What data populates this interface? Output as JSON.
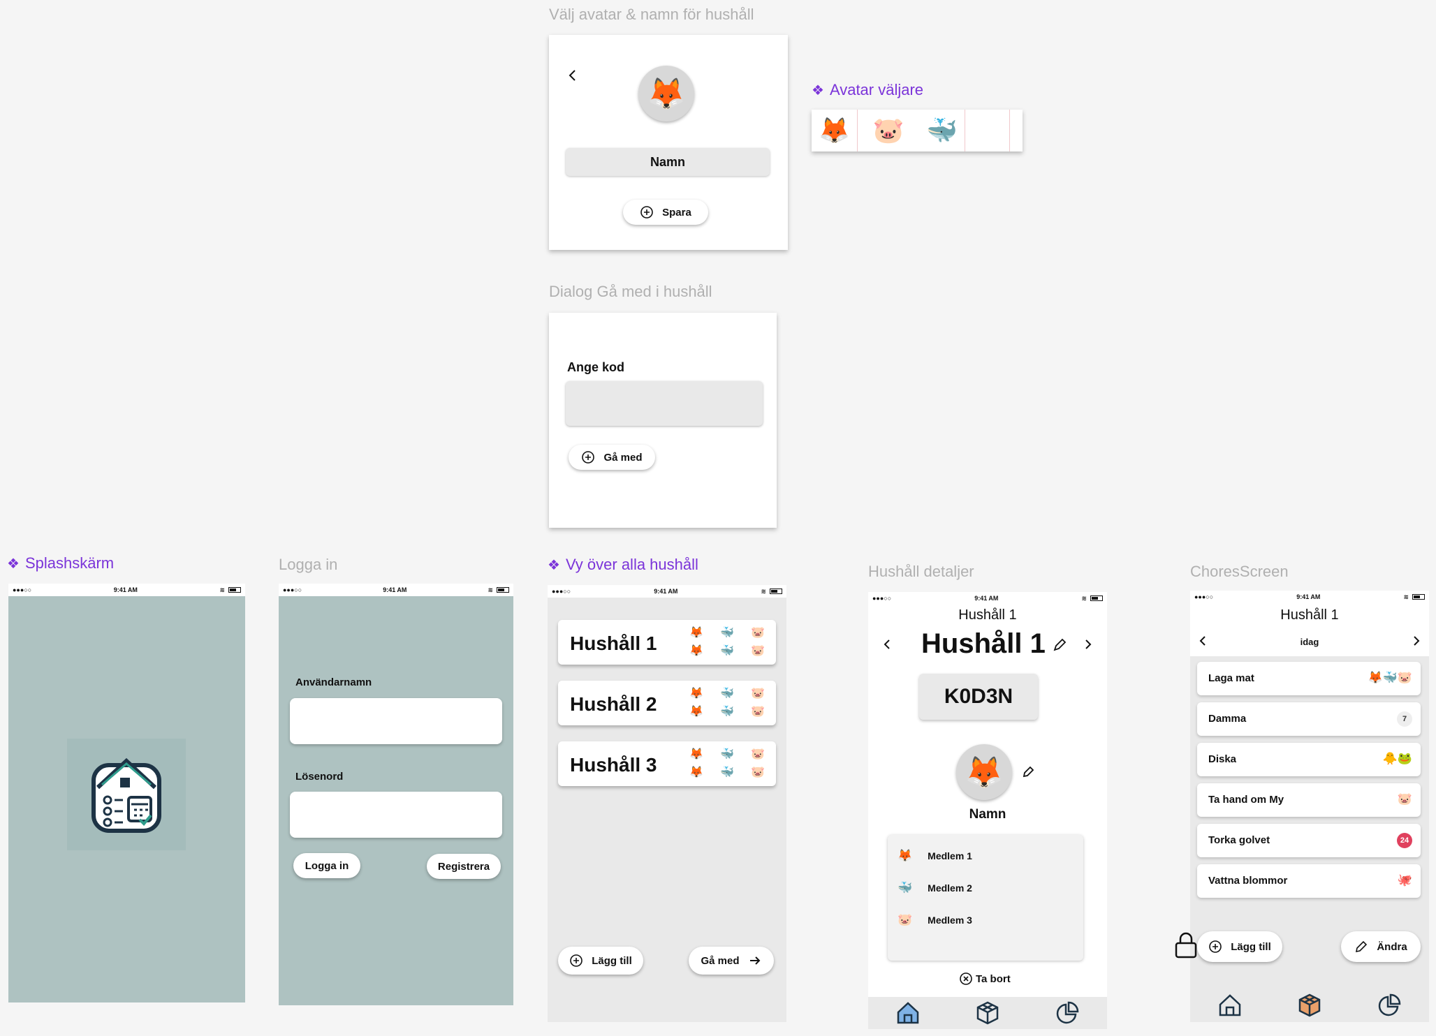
{
  "frames": {
    "avatar_name": {
      "title": "Välj avatar & namn för hushåll",
      "avatar": "🦊",
      "name_value": "Namn",
      "save_label": "Spara"
    },
    "avatar_picker": {
      "title": "Avatar väljare",
      "avatars": [
        "🦊",
        "🐷",
        "🐳"
      ]
    },
    "join_dialog": {
      "title": "Dialog Gå med i hushåll",
      "code_label": "Ange kod",
      "code_value": "",
      "join_label": "Gå med"
    },
    "splash": {
      "title": "Splashskärm",
      "time": "9:41 AM",
      "signal": "●●●○○"
    },
    "login": {
      "title": "Logga in",
      "time": "9:41 AM",
      "signal": "●●●○○",
      "username_label": "Användarnamn",
      "username_value": "",
      "password_label": "Lösenord",
      "password_value": "",
      "login_label": "Logga in",
      "register_label": "Registrera"
    },
    "households": {
      "title": "Vy över alla hushåll",
      "time": "9:41 AM",
      "signal": "●●●○○",
      "items": [
        {
          "name": "Hushåll 1",
          "avatars": [
            "🦊",
            "🐳",
            "🐷",
            "🦊",
            "🐳",
            "🐷"
          ]
        },
        {
          "name": "Hushåll 2",
          "avatars": [
            "🦊",
            "🐳",
            "🐷",
            "🦊",
            "🐳",
            "🐷"
          ]
        },
        {
          "name": "Hushåll 3",
          "avatars": [
            "🦊",
            "🐳",
            "🐷",
            "🦊",
            "🐳",
            "🐷"
          ]
        }
      ],
      "add_label": "Lägg till",
      "join_label": "Gå med"
    },
    "household_detail": {
      "title": "Hushåll detaljer",
      "time": "9:41 AM",
      "signal": "●●●○○",
      "small_title": "Hushåll 1",
      "big_title": "Hushåll 1",
      "code": "K0D3N",
      "avatar": "🦊",
      "name": "Namn",
      "members": [
        {
          "avatar": "🦊",
          "name": "Medlem  1"
        },
        {
          "avatar": "🐳",
          "name": "Medlem  2"
        },
        {
          "avatar": "🐷",
          "name": "Medlem  3"
        }
      ],
      "remove_label": "Ta bort"
    },
    "chores": {
      "title": "ChoresScreen",
      "time": "9:41 AM",
      "signal": "●●●○○",
      "household": "Hushåll 1",
      "day": "idag",
      "items": [
        {
          "name": "Laga mat",
          "right": "🦊🐳🐷"
        },
        {
          "name": "Damma",
          "badge": "7"
        },
        {
          "name": "Diska",
          "right": "🐥🐸"
        },
        {
          "name": "Ta hand om My",
          "right": "🐷"
        },
        {
          "name": "Torka golvet",
          "badge": "24"
        },
        {
          "name": "Vattna blommor",
          "right": "🐙"
        }
      ],
      "add_label": "Lägg till",
      "edit_label": "Ändra"
    }
  },
  "colors": {
    "accent_purple": "#7b34d9",
    "phone_teal": "#aec2c1",
    "badge_grey": "#eeeeee",
    "badge_red": "#e0415e",
    "nav_active": "#7fb2e6"
  }
}
